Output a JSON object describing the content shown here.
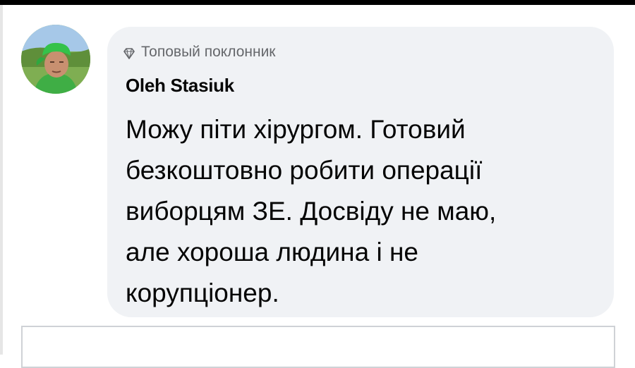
{
  "comment": {
    "badge_label": "Топовый поклонник",
    "badge_icon": "diamond-icon",
    "author_name": "Oleh Stasiuk",
    "text": "Можу піти хірургом. Готовий\nбезкоштовно робити операції\nвиборцям ЗЕ. Досвіду не маю,\nале хороша людина і не\nкорупціонер.",
    "avatar_description": "profile photo of man in green bandana",
    "bubble_color": "#f0f2f5",
    "text_color": "#050505",
    "muted_color": "#65676b"
  }
}
